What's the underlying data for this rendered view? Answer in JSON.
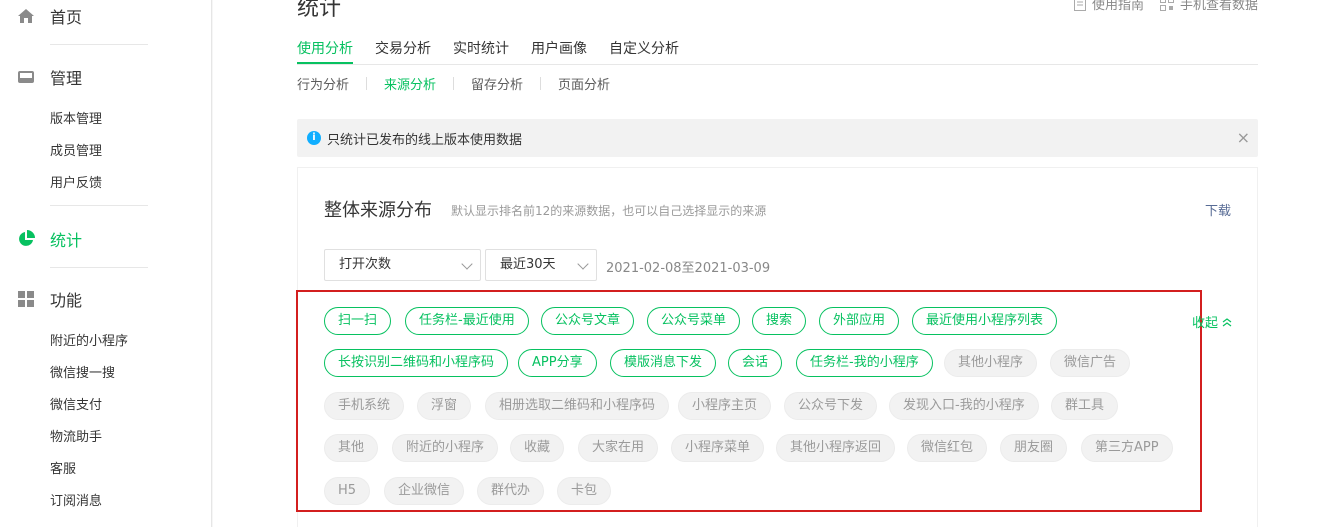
{
  "sidebar": {
    "home": "首页",
    "manage": "管理",
    "manage_items": [
      "版本管理",
      "成员管理",
      "用户反馈"
    ],
    "stats": "统计",
    "features": "功能",
    "feature_items": [
      "附近的小程序",
      "微信搜一搜",
      "微信支付",
      "物流助手",
      "客服",
      "订阅消息"
    ]
  },
  "page": {
    "title": "统计",
    "guide_link": "使用指南",
    "mobile_link": "手机查看数据"
  },
  "tabs": [
    "使用分析",
    "交易分析",
    "实时统计",
    "用户画像",
    "自定义分析"
  ],
  "subtabs": [
    "行为分析",
    "来源分析",
    "留存分析",
    "页面分析"
  ],
  "notice": {
    "text": "只统计已发布的线上版本使用数据",
    "close": "×"
  },
  "panel": {
    "title": "整体来源分布",
    "desc": "默认显示排名前12的来源数据，也可以自己选择显示的来源",
    "download": "下载",
    "metric_select": "打开次数",
    "range_select": "最近30天",
    "date_range": "2021-02-08至2021-03-09",
    "collapse": "收起"
  },
  "selected_tags": [
    "扫一扫",
    "任务栏-最近使用",
    "公众号文章",
    "公众号菜单",
    "搜索",
    "外部应用",
    "最近使用小程序列表",
    "长按识别二维码和小程序码",
    "APP分享",
    "模版消息下发",
    "会话",
    "任务栏-我的小程序"
  ],
  "other_tags": [
    "其他小程序",
    "微信广告",
    "手机系统",
    "浮窗",
    "相册选取二维码和小程序码",
    "小程序主页",
    "公众号下发",
    "发现入口-我的小程序",
    "群工具",
    "其他",
    "附近的小程序",
    "收藏",
    "大家在用",
    "小程序菜单",
    "其他小程序返回",
    "微信红包",
    "朋友圈",
    "第三方APP",
    "H5",
    "企业微信",
    "群代办",
    "卡包"
  ],
  "colors": {
    "accent": "#07c160",
    "link": "#576b95",
    "highlight_box": "#d31f1f"
  }
}
